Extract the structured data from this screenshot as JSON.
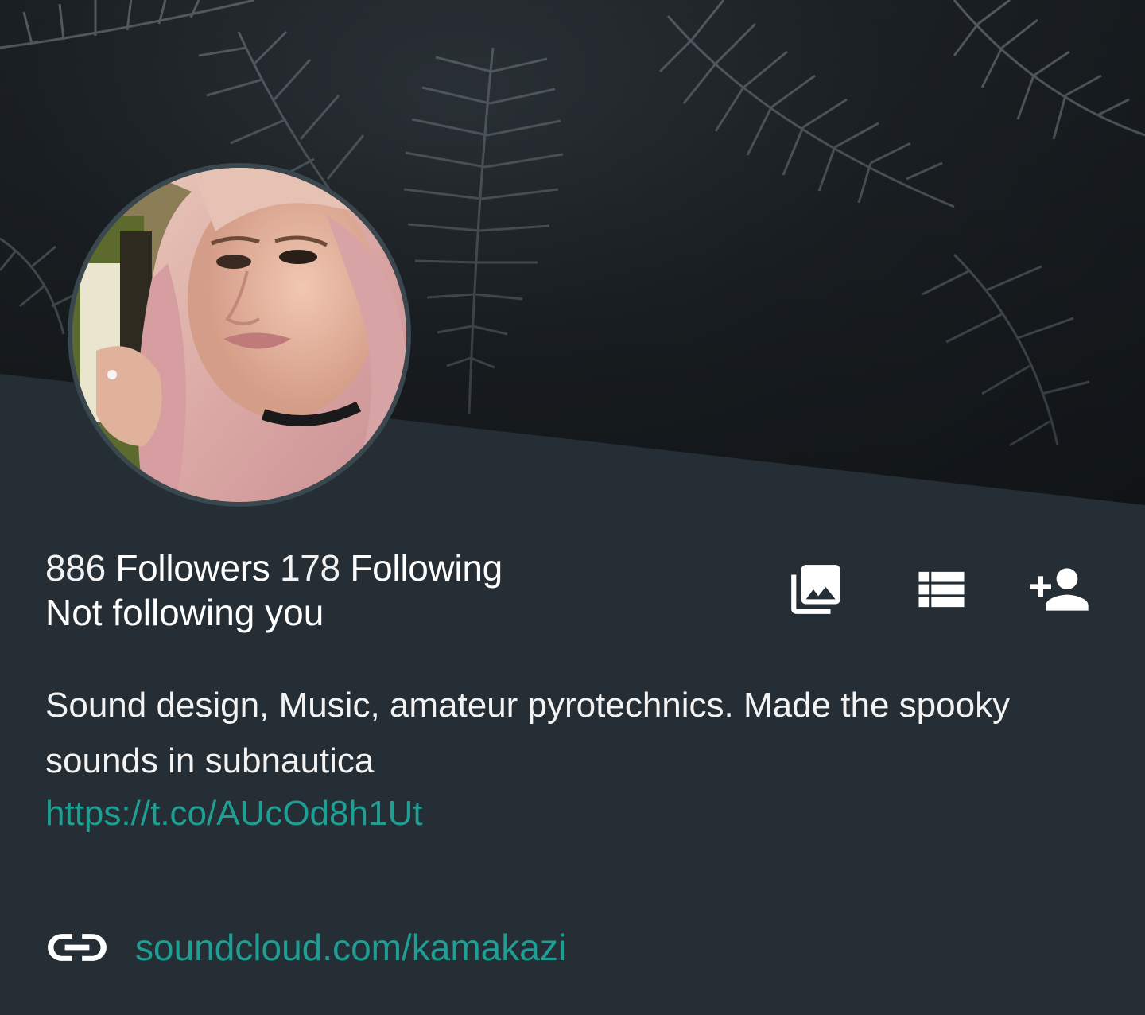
{
  "profile": {
    "followers_count": "886",
    "followers_label": "Followers",
    "following_count": "178",
    "following_label": "Following",
    "follow_status": "Not following you",
    "bio": "Sound design, Music, amateur pyrotechnics. Made the spooky sounds in subnautica",
    "bio_link": "https://t.co/AUcOd8h1Ut",
    "website": "soundcloud.com/kamakazi"
  },
  "actions": [
    {
      "icon": "photo-library-icon"
    },
    {
      "icon": "list-icon"
    },
    {
      "icon": "person-add-icon"
    }
  ],
  "colors": {
    "background": "#252e35",
    "link": "#1f9e94",
    "text": "#ffffff"
  }
}
